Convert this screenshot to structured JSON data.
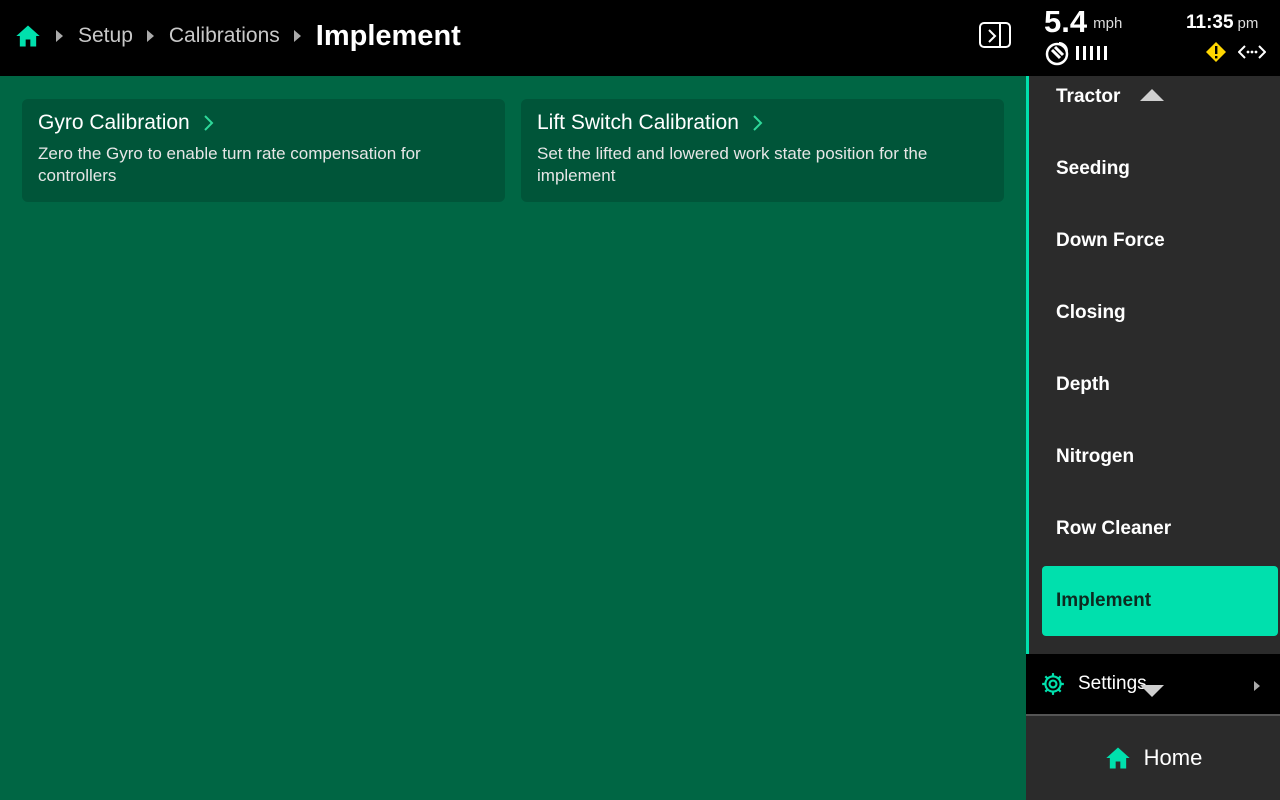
{
  "breadcrumb": {
    "items": [
      "Setup",
      "Calibrations"
    ],
    "current": "Implement"
  },
  "status": {
    "speed_value": "5.4",
    "speed_unit": "mph",
    "time_value": "11:35",
    "time_ampm": "pm",
    "icons": [
      "home-icon",
      "panel-toggle-icon",
      "satellite-icon",
      "signal-bars-icon",
      "warning-icon",
      "connection-icon"
    ]
  },
  "cards": [
    {
      "title": "Gyro Calibration",
      "description": "Zero the Gyro to enable turn rate compensation for controllers"
    },
    {
      "title": "Lift Switch Calibration",
      "description": "Set the lifted and lowered work state position for the implement"
    }
  ],
  "sidebar": {
    "items": [
      {
        "label": "Tractor"
      },
      {
        "label": "Seeding"
      },
      {
        "label": "Down Force"
      },
      {
        "label": "Closing"
      },
      {
        "label": "Depth"
      },
      {
        "label": "Nitrogen"
      },
      {
        "label": "Row Cleaner"
      },
      {
        "label": "Implement",
        "active": true
      }
    ],
    "settings_label": "Settings",
    "home_label": "Home"
  },
  "colors": {
    "accent": "#00e0ad",
    "main_bg": "#006644",
    "card_bg": "#005539",
    "sidebar_bg": "#2b2b2b"
  }
}
